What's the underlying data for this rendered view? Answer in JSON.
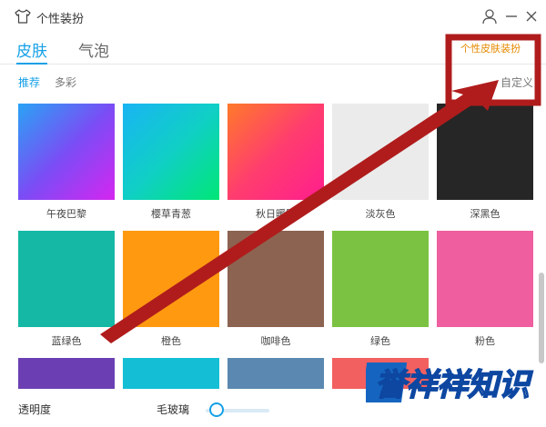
{
  "window": {
    "title": "个性装扮",
    "icons": {
      "app": "tshirt-icon",
      "user": "user-icon",
      "minimize": "minimize-icon",
      "close": "close-icon"
    }
  },
  "tabs": [
    {
      "label": "皮肤",
      "active": true
    },
    {
      "label": "气泡",
      "active": false
    }
  ],
  "promo": "个性皮肤装扮",
  "subtabs": [
    {
      "label": "推荐",
      "active": true
    },
    {
      "label": "多彩",
      "active": false
    }
  ],
  "custom_label": "自定义",
  "swatches": [
    {
      "label": "午夜巴黎",
      "colors": [
        "#2aa3f5",
        "#7a4df5",
        "#d526f0"
      ]
    },
    {
      "label": "樱草青葱",
      "colors": [
        "#19b4f3",
        "#10cfc6",
        "#00e676"
      ]
    },
    {
      "label": "秋日暖阳",
      "colors": [
        "#ff7a2a",
        "#ff3d6e",
        "#ff1e8e"
      ]
    },
    {
      "label": "淡灰色",
      "colors": [
        "#ebebeb"
      ]
    },
    {
      "label": "深黑色",
      "colors": [
        "#262626"
      ]
    },
    {
      "label": "蓝绿色",
      "colors": [
        "#14b8a5"
      ]
    },
    {
      "label": "橙色",
      "colors": [
        "#ff9a10"
      ]
    },
    {
      "label": "咖啡色",
      "colors": [
        "#8c6350"
      ]
    },
    {
      "label": "绿色",
      "colors": [
        "#7cc242"
      ]
    },
    {
      "label": "粉色",
      "colors": [
        "#ef5f9f"
      ]
    },
    {
      "label": "",
      "colors": [
        "#6b3fb3"
      ]
    },
    {
      "label": "",
      "colors": [
        "#14bfd5"
      ]
    },
    {
      "label": "",
      "colors": [
        "#5a88b0"
      ]
    },
    {
      "label": "",
      "colors": [
        "#f26060"
      ]
    }
  ],
  "bottom": {
    "transparency_label": "透明度",
    "frosted_label": "毛玻璃",
    "frosted_level": 0.15
  },
  "watermark": "誉祥祥知识",
  "colors": {
    "accent": "#15a0e6",
    "annotation": "#b01c1c"
  }
}
